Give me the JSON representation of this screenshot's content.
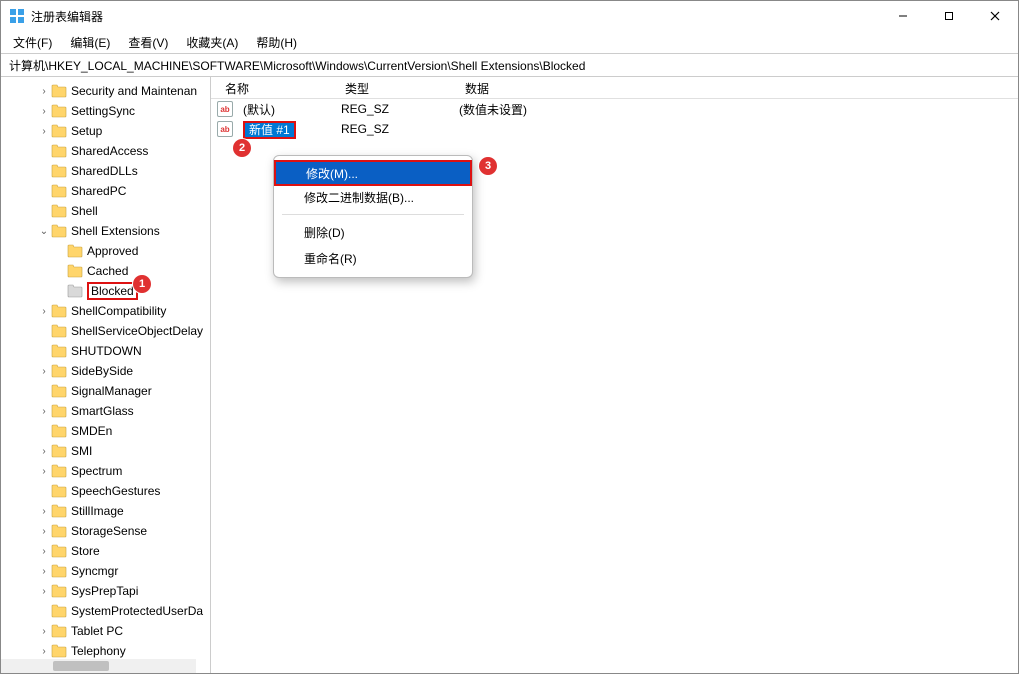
{
  "window": {
    "title": "注册表编辑器"
  },
  "menu": {
    "file": "文件(F)",
    "edit": "编辑(E)",
    "view": "查看(V)",
    "favorites": "收藏夹(A)",
    "help": "帮助(H)"
  },
  "address": "计算机\\HKEY_LOCAL_MACHINE\\SOFTWARE\\Microsoft\\Windows\\CurrentVersion\\Shell Extensions\\Blocked",
  "columns": {
    "name": "名称",
    "type": "类型",
    "data": "数据"
  },
  "values": {
    "default": {
      "name": "(默认)",
      "type": "REG_SZ",
      "data": "(数值未设置)"
    },
    "newval": {
      "name": "新值 #1",
      "type": "REG_SZ",
      "data": ""
    }
  },
  "context_menu": {
    "modify": "修改(M)...",
    "modify_binary": "修改二进制数据(B)...",
    "delete": "删除(D)",
    "rename": "重命名(R)"
  },
  "tree": {
    "items": [
      {
        "label": "Security and Maintenan",
        "depth": 2,
        "chev": ">"
      },
      {
        "label": "SettingSync",
        "depth": 2,
        "chev": ">"
      },
      {
        "label": "Setup",
        "depth": 2,
        "chev": ">"
      },
      {
        "label": "SharedAccess",
        "depth": 2,
        "chev": ""
      },
      {
        "label": "SharedDLLs",
        "depth": 2,
        "chev": ""
      },
      {
        "label": "SharedPC",
        "depth": 2,
        "chev": ""
      },
      {
        "label": "Shell",
        "depth": 2,
        "chev": ""
      },
      {
        "label": "Shell Extensions",
        "depth": 2,
        "chev": "v"
      },
      {
        "label": "Approved",
        "depth": 3,
        "chev": ""
      },
      {
        "label": "Cached",
        "depth": 3,
        "chev": ""
      },
      {
        "label": "Blocked",
        "depth": 3,
        "chev": "",
        "selected": true
      },
      {
        "label": "ShellCompatibility",
        "depth": 2,
        "chev": ">"
      },
      {
        "label": "ShellServiceObjectDelay",
        "depth": 2,
        "chev": ""
      },
      {
        "label": "SHUTDOWN",
        "depth": 2,
        "chev": ""
      },
      {
        "label": "SideBySide",
        "depth": 2,
        "chev": ">"
      },
      {
        "label": "SignalManager",
        "depth": 2,
        "chev": ""
      },
      {
        "label": "SmartGlass",
        "depth": 2,
        "chev": ">"
      },
      {
        "label": "SMDEn",
        "depth": 2,
        "chev": ""
      },
      {
        "label": "SMI",
        "depth": 2,
        "chev": ">"
      },
      {
        "label": "Spectrum",
        "depth": 2,
        "chev": ">"
      },
      {
        "label": "SpeechGestures",
        "depth": 2,
        "chev": ""
      },
      {
        "label": "StillImage",
        "depth": 2,
        "chev": ">"
      },
      {
        "label": "StorageSense",
        "depth": 2,
        "chev": ">"
      },
      {
        "label": "Store",
        "depth": 2,
        "chev": ">"
      },
      {
        "label": "Syncmgr",
        "depth": 2,
        "chev": ">"
      },
      {
        "label": "SysPrepTapi",
        "depth": 2,
        "chev": ">"
      },
      {
        "label": "SystemProtectedUserDa",
        "depth": 2,
        "chev": ""
      },
      {
        "label": "Tablet PC",
        "depth": 2,
        "chev": ">"
      },
      {
        "label": "Telephony",
        "depth": 2,
        "chev": ">"
      }
    ]
  },
  "annotations": {
    "marker1": "1",
    "marker2": "2",
    "marker3": "3"
  },
  "icons": {
    "val_text": "ab"
  }
}
